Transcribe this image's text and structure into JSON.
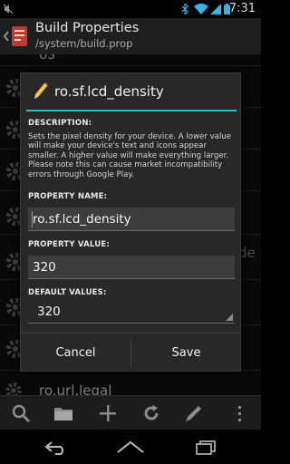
{
  "status_bar": {
    "time": "7:31",
    "icons": [
      "mute-icon",
      "bluetooth-icon",
      "wifi-icon",
      "signal-icon",
      "battery-icon"
    ]
  },
  "action_bar": {
    "title": "Build Properties",
    "subtitle": "/system/build.prop",
    "icons": [
      "back-arrow-icon",
      "app-icon"
    ]
  },
  "background_list": {
    "top_partial_text": "US",
    "side_partial_text": "de",
    "last_visible_item": "ro.url.legal"
  },
  "dialog": {
    "title": "ro.sf.lcd_density",
    "description_label": "DESCRIPTION:",
    "description": "Sets the pixel density for your device. A lower value will make your device's text and icons appear smaller. A higher value will make everything larger. Please note this can cause market incompatibility errors through Google Play.",
    "property_name_label": "PROPERTY NAME:",
    "property_name_value": "ro.sf.lcd_density",
    "property_value_label": "PROPERTY VALUE:",
    "property_value": "320",
    "default_values_label": "DEFAULT VALUES:",
    "default_value_selected": "320",
    "cancel_label": "Cancel",
    "save_label": "Save"
  },
  "toolbar": {
    "icons": [
      "search-icon",
      "folder-icon",
      "add-icon",
      "refresh-icon",
      "edit-icon",
      "overflow-menu-icon"
    ]
  },
  "nav_bar": {
    "icons": [
      "back-icon",
      "home-icon",
      "recents-icon"
    ]
  },
  "colors": {
    "accent": "#33b5e5",
    "dialog_bg": "#282828",
    "actionbar_bg": "#1e1e1e"
  }
}
